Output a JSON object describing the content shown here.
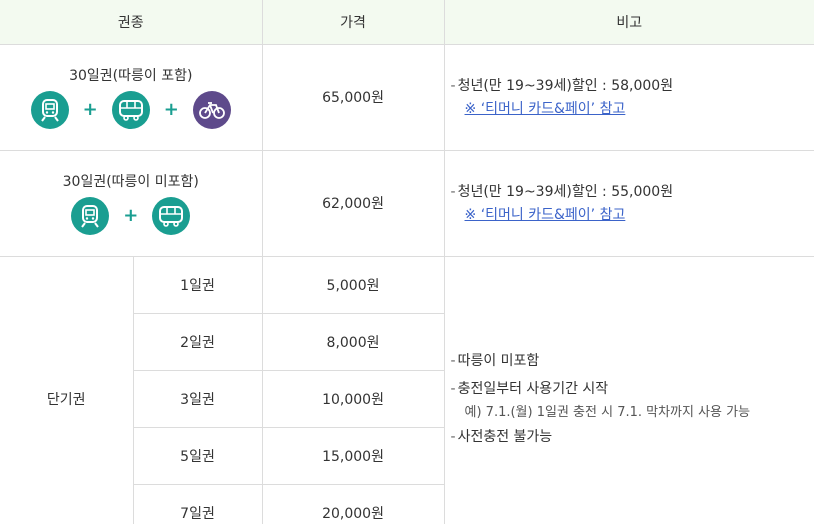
{
  "header": {
    "col_type": "권종",
    "col_price": "가격",
    "col_note": "비고"
  },
  "rows": [
    {
      "name": "30일권(따릉이 포함)",
      "price": "65,000원",
      "note_main": "청년(만 19~39세)할인 : 58,000원",
      "note_link": "※ ‘티머니 카드&페이’ 참고",
      "icons": [
        "subway-icon",
        "bus-icon",
        "bicycle-icon"
      ]
    },
    {
      "name": "30일권(따릉이 미포함)",
      "price": "62,000원",
      "note_main": "청년(만 19~39세)할인 : 55,000원",
      "note_link": "※ ‘티머니 카드&페이’ 참고",
      "icons": [
        "subway-icon",
        "bus-icon"
      ]
    }
  ],
  "short": {
    "label": "단기권",
    "items": [
      {
        "name": "1일권",
        "price": "5,000원"
      },
      {
        "name": "2일권",
        "price": "8,000원"
      },
      {
        "name": "3일권",
        "price": "10,000원"
      },
      {
        "name": "5일권",
        "price": "15,000원"
      },
      {
        "name": "7일권",
        "price": "20,000원"
      }
    ],
    "notes": {
      "n1": "따릉이 미포함",
      "n2": "충전일부터 사용기간 시작",
      "n2_sub": "예) 7.1.(월) 1일권 충전 시 7.1. 막차까지 사용 가능",
      "n3": "사전충전 불가능"
    }
  },
  "colors": {
    "header_bg": "#f3faf0",
    "teal": "#1a9e91",
    "purple": "#5e4a8b",
    "link": "#3b63c9"
  }
}
